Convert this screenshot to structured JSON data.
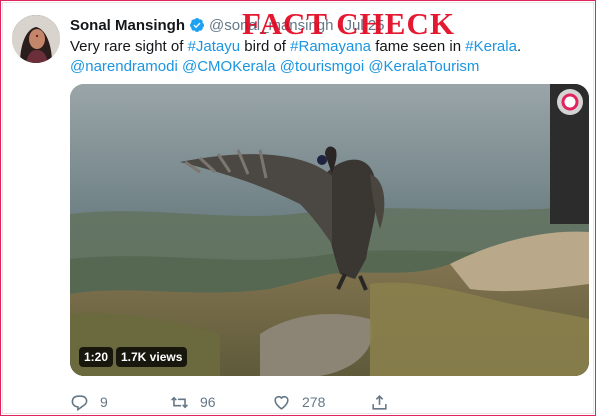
{
  "tweet": {
    "author_name": "Sonal Mansingh",
    "handle": "@sonal_mansingh",
    "date": "Jul 25",
    "separator": "·",
    "text_parts": [
      {
        "t": "Very rare sight of ",
        "tag": false
      },
      {
        "t": "#Jatayu",
        "tag": true
      },
      {
        "t": " bird of ",
        "tag": false
      },
      {
        "t": "#Ramayana",
        "tag": true
      },
      {
        "t": " fame seen in ",
        "tag": false
      },
      {
        "t": "#Kerala",
        "tag": true
      },
      {
        "t": ".",
        "tag": false
      }
    ],
    "mentions": [
      "@narendramodi",
      "@CMOKerala",
      "@tourismgoi",
      "@KeralaTourism"
    ]
  },
  "overlay": {
    "stamp": "FACT CHECK"
  },
  "video": {
    "duration": "1:20",
    "views": "1.7K views"
  },
  "actions": {
    "reply_count": "9",
    "retweet_count": "96",
    "like_count": "278"
  },
  "colors": {
    "link": "#1b95e0",
    "stamp": "#e2001a",
    "meta": "#657786",
    "verified": "#1da1f2"
  }
}
